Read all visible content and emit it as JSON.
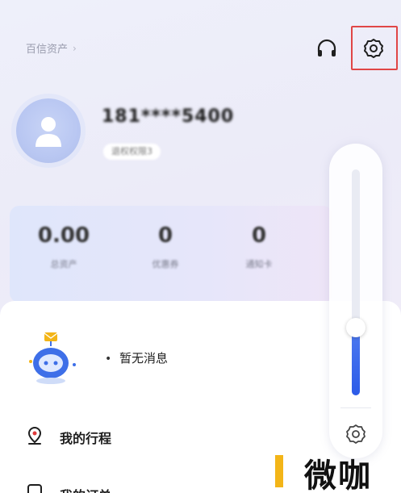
{
  "header": {
    "breadcrumb_label": "百信资产",
    "breadcrumb_chevron": "›",
    "icons": {
      "support": "headset-icon",
      "settings": "gear-icon"
    }
  },
  "profile": {
    "phone": "181****5400",
    "id_badge": "退权权限3"
  },
  "stats": [
    {
      "value": "0.00",
      "label": "总资产"
    },
    {
      "value": "0",
      "label": "优惠券"
    },
    {
      "value": "0",
      "label": "通知卡"
    }
  ],
  "messages": {
    "bullet": "•",
    "empty_text": "暂无消息"
  },
  "menu": [
    {
      "icon": "location-pin-icon",
      "label": "我的行程"
    },
    {
      "icon": "document-icon",
      "label": "我的订单"
    }
  ],
  "volume_panel": {
    "level": 0.3,
    "settings_icon": "gear-icon"
  },
  "watermark": {
    "text": "微咖"
  },
  "colors": {
    "accent": "#2c5be8",
    "highlight": "#e04646",
    "watermark": "#f3b518"
  }
}
